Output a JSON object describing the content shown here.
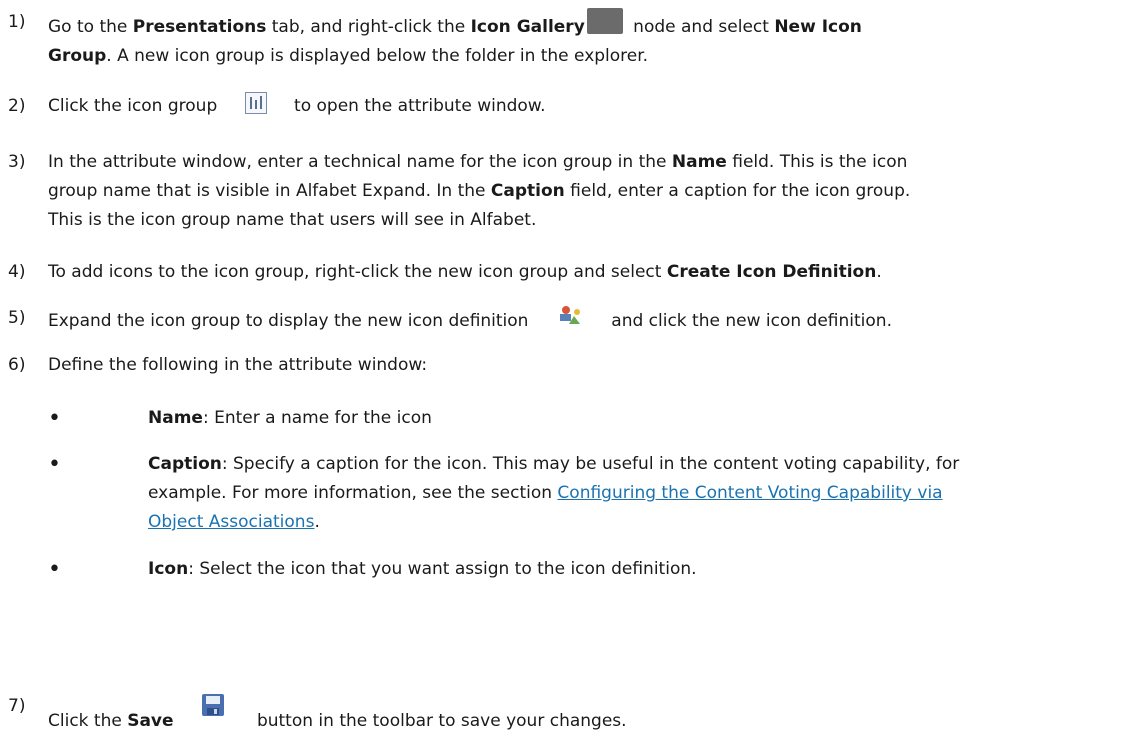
{
  "steps": [
    {
      "n": "1)",
      "a": "Go to the ",
      "b1": "Presentations",
      "c": " tab, and right-click the ",
      "b2": "Icon Gallery",
      "d": " node and select ",
      "b3": "New Icon",
      "l2b": "Group",
      "l2": ". A new icon group is displayed below the folder in the explorer."
    },
    {
      "n": "2)",
      "a": "Click the icon group ",
      "b": " to open the attribute window."
    },
    {
      "n": "3)",
      "a": "In the attribute window, enter a technical name for the icon group in the ",
      "b1": "Name",
      "c": " field. This is the icon",
      "l2a": "group name that is visible in Alfabet Expand. In the ",
      "b2": "Caption",
      "l2c": " field, enter a caption for the icon group.",
      "l3": "This is the icon group name that users will see in Alfabet."
    },
    {
      "n": "4)",
      "a": "To add icons to the icon group, right-click the new icon group and select ",
      "b": "Create Icon Definition",
      "c": "."
    },
    {
      "n": "5)",
      "a": "Expand the icon group to display the new icon definition ",
      "b": " and click the new icon definition."
    },
    {
      "n": "6)",
      "a": "Define the following in the attribute window:"
    },
    {
      "n": "7)",
      "a": "Click the ",
      "b": "Save",
      "c": " button in the toolbar to save your changes."
    }
  ],
  "bullets": [
    {
      "bullet": "•",
      "label": "Name",
      "text": ": Enter a name for the icon"
    },
    {
      "bullet": "•",
      "label": "Caption",
      "text": ": Specify a caption for the icon. This may be useful in the content voting capability, for",
      "line2": "example. For more information, see the section ",
      "link1": "Configuring the Content Voting Capability via ",
      "link2": "Object Associations",
      "end": "."
    },
    {
      "bullet": "•",
      "label": "Icon",
      "text": ": Select the icon that you want assign to the icon definition."
    }
  ],
  "icons": {
    "gallery": "folder-icon",
    "group": "icon-group-icon",
    "definition": "icon-definition-icon",
    "save": "save-icon"
  }
}
